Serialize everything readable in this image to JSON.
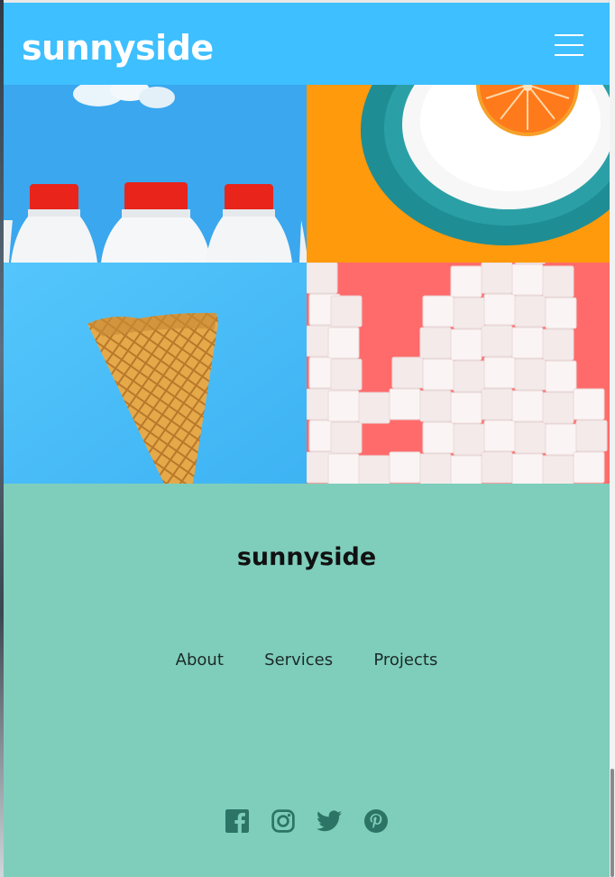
{
  "header": {
    "logo": "sunnyside",
    "menu_icon": "hamburger-menu-icon",
    "bg_color": "#3ebfff"
  },
  "gallery": [
    {
      "name": "milk-bottles-image"
    },
    {
      "name": "orange-plate-image"
    },
    {
      "name": "waffle-cone-image"
    },
    {
      "name": "sugar-cubes-image"
    }
  ],
  "footer": {
    "logo": "sunnyside",
    "bg_color": "#7fcebc",
    "nav": [
      "About",
      "Services",
      "Projects"
    ],
    "social": [
      "facebook-icon",
      "instagram-icon",
      "twitter-icon",
      "pinterest-icon"
    ]
  }
}
